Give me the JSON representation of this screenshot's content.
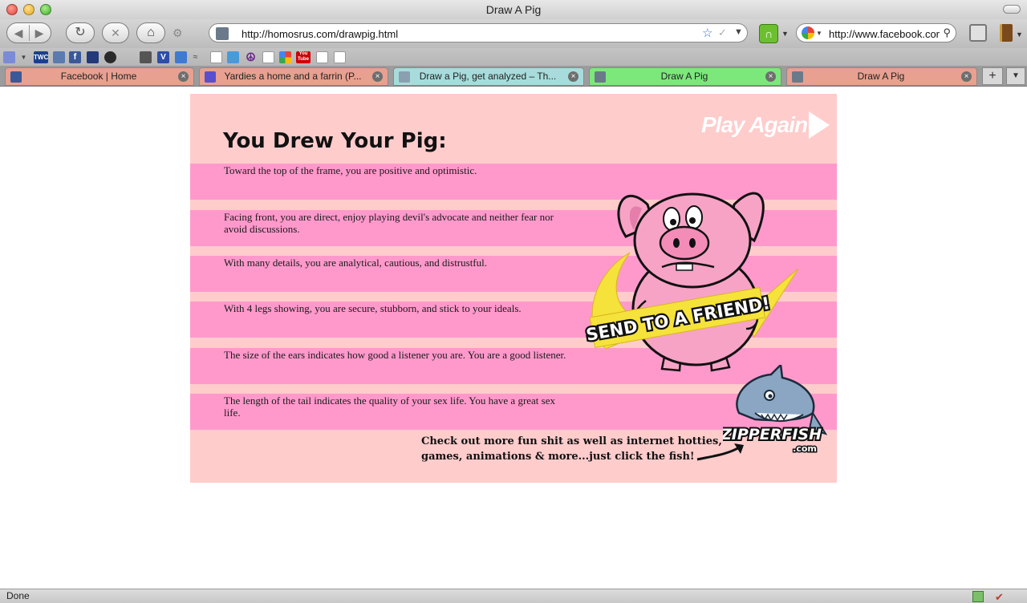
{
  "window": {
    "title": "Draw A Pig"
  },
  "toolbar": {
    "url": "http://homosrus.com/drawpig.html",
    "search_value": "http://www.facebook.com"
  },
  "bookmarks": [
    {
      "icon": "twc-icon",
      "label": "TWC",
      "color": "#1b3f8f"
    },
    {
      "icon": "facebook-icon",
      "label": "f",
      "color": "#3b5998"
    },
    {
      "icon": "peace-icon",
      "label": "☮",
      "color": "#6a2a8a"
    },
    {
      "icon": "youtube-icon",
      "label": "You Tube",
      "color": "#cc0000"
    }
  ],
  "tabs": [
    {
      "label": "Facebook | Home",
      "bg": "#e8a090",
      "icon_color": "#3b5998",
      "active": false
    },
    {
      "label": "Yardies a home and a farrin (P...",
      "bg": "#e8a090",
      "icon_color": "#5a4fcf",
      "active": false
    },
    {
      "label": "Draw a Pig, get analyzed – Th...",
      "bg": "#a8dcdc",
      "icon_color": "#8aa0b0",
      "active": false
    },
    {
      "label": "Draw A Pig",
      "bg": "#7ce87c",
      "icon_color": "#6b7a8a",
      "active": true
    },
    {
      "label": "Draw A Pig",
      "bg": "#e8a090",
      "icon_color": "#6b7a8a",
      "active": false
    }
  ],
  "page": {
    "heading": "You Drew Your Pig:",
    "play_again": "Play Again",
    "results": [
      "Toward the top of the frame, you are positive and optimistic.",
      "Facing front, you are direct, enjoy playing devil's advocate and neither fear nor avoid discussions.",
      "With many details, you are analytical, cautious, and distrustful.",
      "With 4 legs showing, you are secure, stubborn, and stick to your ideals.",
      "The size of the ears indicates how good a listener you are. You are a good listener.",
      "The length of the tail indicates the quality of your sex life. You have a great sex life."
    ],
    "send_to_friend": "SEND TO A FRIEND!",
    "zipperfish_logo": "ZIPPERFISH",
    "zipperfish_domain": ".com",
    "promo": "Check out more fun shit as well as internet hotties, games, animations & more...just click the fish!"
  },
  "colors": {
    "page_bg": "#ffcccc",
    "band": "#ff99cc",
    "pig_pink": "#f7a3c6",
    "ribbon_yellow": "#f5e23a"
  },
  "status": {
    "text": "Done"
  }
}
